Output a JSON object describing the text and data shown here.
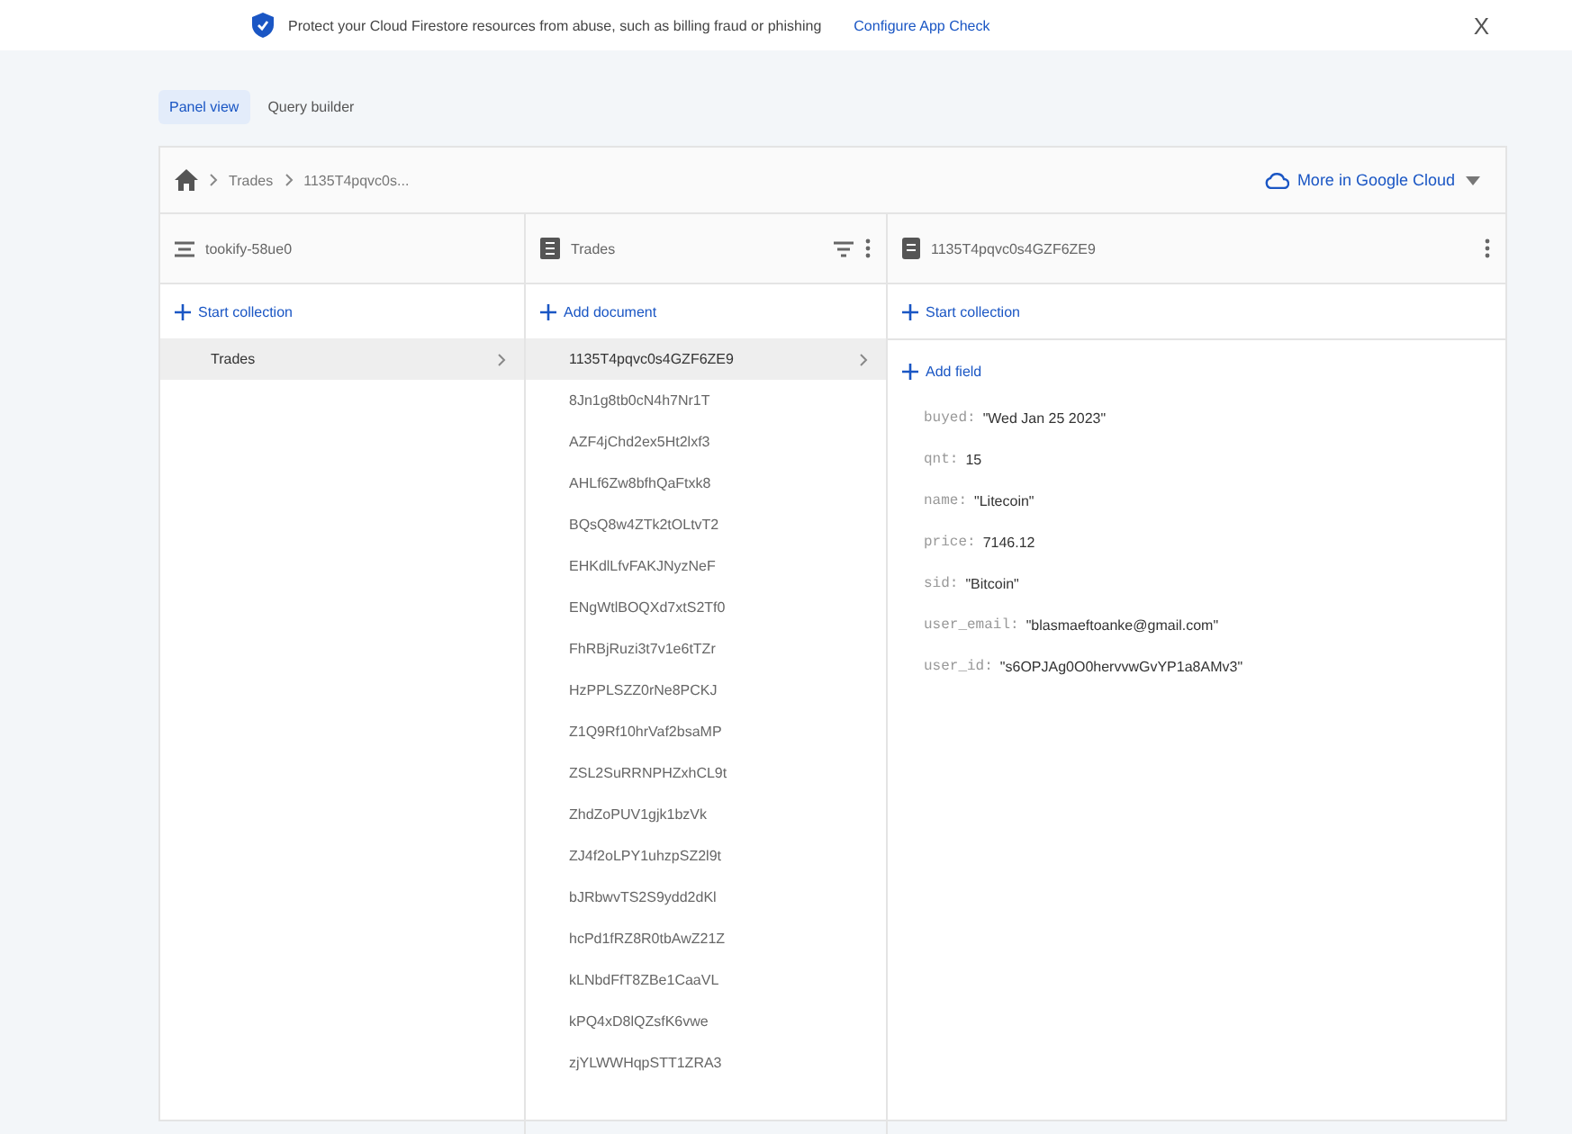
{
  "banner": {
    "message": "Protect your Cloud Firestore resources from abuse, such as billing fraud or phishing",
    "link": "Configure App Check",
    "close": "X"
  },
  "tabs": [
    {
      "label": "Panel view",
      "selected": true
    },
    {
      "label": "Query builder",
      "selected": false
    }
  ],
  "breadcrumb": {
    "items": [
      "Trades",
      "1135T4pqvc0s..."
    ],
    "cloud_link": "More in Google Cloud"
  },
  "columns": [
    {
      "kind": "root",
      "title": "tookify-58ue0",
      "action": "Start collection",
      "items": [
        {
          "label": "Trades",
          "selected": true
        }
      ]
    },
    {
      "kind": "collection",
      "title": "Trades",
      "action": "Add document",
      "items": [
        {
          "label": "1135T4pqvc0s4GZF6ZE9",
          "selected": true
        },
        {
          "label": "8Jn1g8tb0cN4h7Nr1T",
          "selected": false
        },
        {
          "label": "AZF4jChd2ex5Ht2lxf3",
          "selected": false
        },
        {
          "label": "AHLf6Zw8bfhQaFtxk8",
          "selected": false
        },
        {
          "label": "BQsQ8w4ZTk2tOLtvT2",
          "selected": false
        },
        {
          "label": "EHKdlLfvFAKJNyzNeF",
          "selected": false
        },
        {
          "label": "ENgWtlBOQXd7xtS2Tf0",
          "selected": false
        },
        {
          "label": "FhRBjRuzi3t7v1e6tTZr",
          "selected": false
        },
        {
          "label": "HzPPLSZZ0rNe8PCKJ",
          "selected": false
        },
        {
          "label": "Z1Q9Rf10hrVaf2bsaMP",
          "selected": false
        },
        {
          "label": "ZSL2SuRRNPHZxhCL9t",
          "selected": false
        },
        {
          "label": "ZhdZoPUV1gjk1bzVk",
          "selected": false
        },
        {
          "label": "ZJ4f2oLPY1uhzpSZ2l9t",
          "selected": false
        },
        {
          "label": "bJRbwvTS2S9ydd2dKl",
          "selected": false
        },
        {
          "label": "hcPd1fRZ8R0tbAwZ21Z",
          "selected": false
        },
        {
          "label": "kLNbdFfT8ZBe1CaaVL",
          "selected": false
        },
        {
          "label": "kPQ4xD8lQZsfK6vwe",
          "selected": false
        },
        {
          "label": "zjYLWWHqpSTT1ZRA3",
          "selected": false
        }
      ]
    },
    {
      "kind": "document",
      "title": "1135T4pqvc0s4GZF6ZE9",
      "action": "Start collection",
      "add_field": "Add field",
      "fields": [
        {
          "key": "buyed:",
          "value": "\"Wed Jan 25 2023\""
        },
        {
          "key": "qnt:",
          "value": "15"
        },
        {
          "key": "name:",
          "value": "\"Litecoin\""
        },
        {
          "key": "price:",
          "value": "7146.12"
        },
        {
          "key": "sid:",
          "value": "\"Bitcoin\""
        },
        {
          "key": "user_email:",
          "value": "\"blasmaeftoanke@gmail.com\""
        },
        {
          "key": "user_id:",
          "value": "\"s6OPJAg0O0hervvwGvYP1a8AMv3\""
        }
      ]
    }
  ]
}
